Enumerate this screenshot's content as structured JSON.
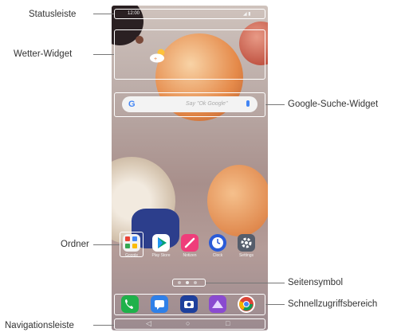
{
  "labels": {
    "statusbar": "Statusleiste",
    "weather_widget": "Wetter-Widget",
    "google_search_widget": "Google-Suche-Widget",
    "folder": "Ordner",
    "page_icon": "Seitensymbol",
    "quick_access": "Schnellzugriffsbereich",
    "navigation_bar": "Navigationsleiste"
  },
  "screen": {
    "status_time": "12:00",
    "search_brand": "G",
    "search_placeholder": "Say \"Ok Google\"",
    "apps": [
      {
        "label": "Google",
        "icon": "folder-icon"
      },
      {
        "label": "Play Store",
        "icon": "play-store-icon"
      },
      {
        "label": "Notizen",
        "icon": "pen-icon"
      },
      {
        "label": "Clock",
        "icon": "clock-icon"
      },
      {
        "label": "Settings",
        "icon": "gear-icon"
      }
    ],
    "dock": [
      {
        "icon": "phone-icon",
        "color": "#1fb14a"
      },
      {
        "icon": "messages-icon",
        "color": "#2f80e8"
      },
      {
        "icon": "camera-icon",
        "color": "#1d3f9c"
      },
      {
        "icon": "gallery-icon",
        "color": "#8a4bd0"
      },
      {
        "icon": "chrome-icon",
        "color": "#ffffff"
      }
    ],
    "nav": [
      "◁",
      "○",
      "□"
    ]
  }
}
